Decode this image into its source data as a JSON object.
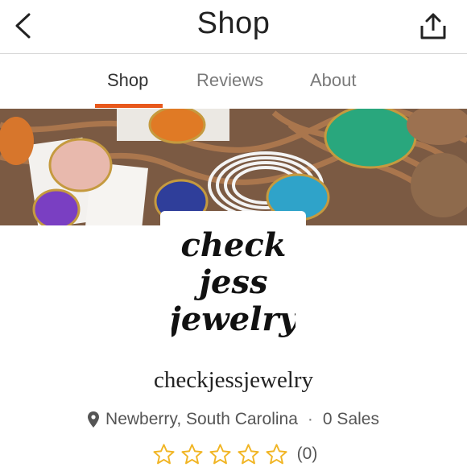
{
  "header": {
    "title": "Shop",
    "back_icon": "chevron-left-icon",
    "share_icon": "share-icon"
  },
  "tabs": [
    {
      "label": "Shop",
      "active": true
    },
    {
      "label": "Reviews",
      "active": false
    },
    {
      "label": "About",
      "active": false
    }
  ],
  "colors": {
    "accent": "#e8581c",
    "star_outline": "#f1b524",
    "text_muted": "#555555"
  },
  "logo": {
    "lines": [
      "check",
      "jess",
      "jewelry"
    ]
  },
  "shop": {
    "name": "checkjessjewelry",
    "location": "Newberry, South Carolina",
    "separator": "·",
    "sales": "0 Sales",
    "rating_stars": 0,
    "rating_max": 5,
    "review_count": "(0)"
  }
}
